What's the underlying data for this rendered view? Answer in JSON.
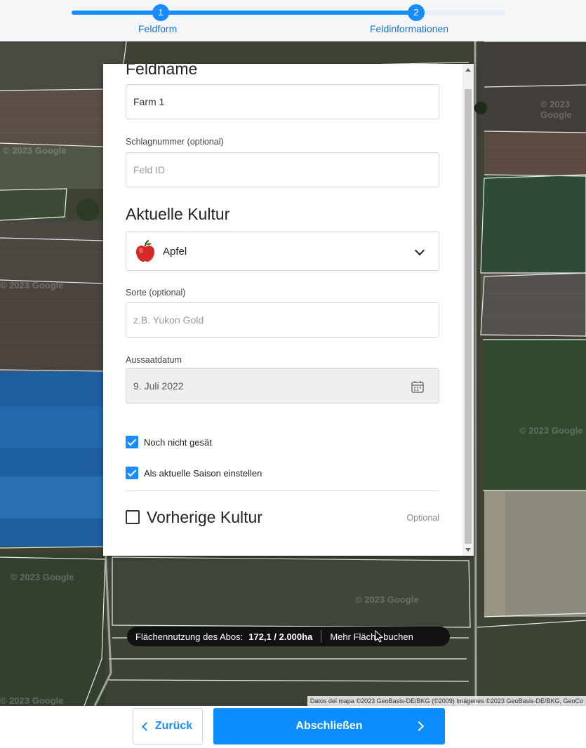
{
  "stepper": {
    "step1": {
      "number": "1",
      "label": "Feldform"
    },
    "step2": {
      "number": "2",
      "label": "Feldinformationen"
    }
  },
  "form": {
    "field_name_heading": "Feldname",
    "field_name_value": "Farm 1",
    "plot_number_label": "Schlagnummer (optional)",
    "plot_number_placeholder": "Feld ID",
    "current_crop_heading": "Aktuelle Kultur",
    "current_crop_value": "Apfel",
    "current_crop_icon": "apple-icon",
    "variety_label": "Sorte (optional)",
    "variety_placeholder": "z.B. Yukon Gold",
    "sowing_date_label": "Aussaatdatum",
    "sowing_date_value": "9. Juli 2022",
    "not_sown_label": "Noch nicht gesät",
    "not_sown_checked": true,
    "current_season_label": "Als aktuelle Saison einstellen",
    "current_season_checked": true,
    "previous_crop_label": "Vorherige Kultur",
    "previous_crop_checked": false,
    "previous_crop_optional": "Optional"
  },
  "map": {
    "watermark": "© 2023 Google",
    "attribution": "Datos del mapa ©2023 GeoBasis-DE/BKG (©2009) Imágenes ©2023 GeoBasis-DE/BKG, GeoCo",
    "usage_label": "Flächennutzung des Abos:",
    "usage_value": "172,1 / 2.000ha",
    "book_more_label": "Mehr Fläche buchen"
  },
  "footer": {
    "back_label": "Zurück",
    "finish_label": "Abschließen"
  },
  "colors": {
    "accent": "#1a8cff"
  }
}
